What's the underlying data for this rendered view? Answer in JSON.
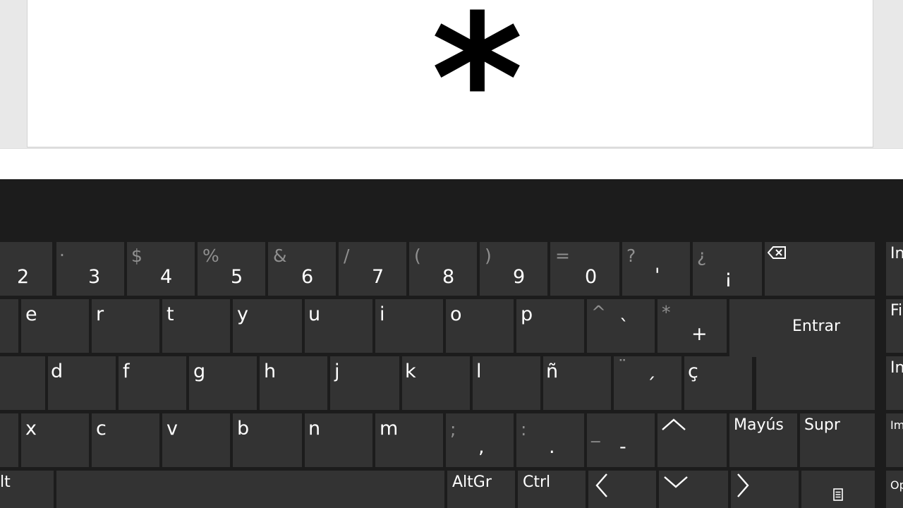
{
  "document": {
    "symbol": "*"
  },
  "keyboard": {
    "rows": [
      [
        {
          "id": "2",
          "main": "2",
          "sec": ""
        },
        {
          "id": "3",
          "main": "3",
          "sec": "·"
        },
        {
          "id": "4",
          "main": "4",
          "sec": "$"
        },
        {
          "id": "5",
          "main": "5",
          "sec": "%"
        },
        {
          "id": "6",
          "main": "6",
          "sec": "&"
        },
        {
          "id": "7",
          "main": "7",
          "sec": "/"
        },
        {
          "id": "8",
          "main": "8",
          "sec": "("
        },
        {
          "id": "9",
          "main": "9",
          "sec": ")"
        },
        {
          "id": "0",
          "main": "0",
          "sec": "="
        },
        {
          "id": "apostrophe",
          "main": "'",
          "sec": "?"
        },
        {
          "id": "inverted-exclamation",
          "main": "¡",
          "sec": "¿"
        }
      ],
      [
        {
          "id": "e",
          "main": "e"
        },
        {
          "id": "r",
          "main": "r"
        },
        {
          "id": "t",
          "main": "t"
        },
        {
          "id": "y",
          "main": "y"
        },
        {
          "id": "u",
          "main": "u"
        },
        {
          "id": "i",
          "main": "i"
        },
        {
          "id": "o",
          "main": "o"
        },
        {
          "id": "p",
          "main": "p"
        },
        {
          "id": "grave",
          "main": "`",
          "sec": "^"
        },
        {
          "id": "plus",
          "main": "+",
          "sec": "*"
        }
      ],
      [
        {
          "id": "d",
          "main": "d"
        },
        {
          "id": "f",
          "main": "f"
        },
        {
          "id": "g",
          "main": "g"
        },
        {
          "id": "h",
          "main": "h"
        },
        {
          "id": "j",
          "main": "j"
        },
        {
          "id": "k",
          "main": "k"
        },
        {
          "id": "l",
          "main": "l"
        },
        {
          "id": "enye",
          "main": "ñ"
        },
        {
          "id": "acute",
          "main": "´",
          "sec": "¨"
        },
        {
          "id": "cedilla",
          "main": "ç"
        }
      ],
      [
        {
          "id": "x",
          "main": "x"
        },
        {
          "id": "c",
          "main": "c"
        },
        {
          "id": "v",
          "main": "v"
        },
        {
          "id": "b",
          "main": "b"
        },
        {
          "id": "n",
          "main": "n"
        },
        {
          "id": "m",
          "main": "m"
        },
        {
          "id": "comma",
          "main": ",",
          "sec": ";"
        },
        {
          "id": "period",
          "main": ".",
          "sec": ":"
        },
        {
          "id": "hyphen",
          "main": "-",
          "sec": "_"
        }
      ]
    ],
    "labels": {
      "enter": "Entrar",
      "shift": "Mayús",
      "delete": "Supr",
      "alt": "lt",
      "altgr": "AltGr",
      "ctrl": "Ctrl"
    },
    "side_keys": [
      "In",
      "Fi",
      "In",
      "Im",
      "Op"
    ],
    "icons": {
      "backspace": "backspace-icon",
      "up": "arrow-up-icon",
      "down": "arrow-down-icon",
      "left": "arrow-left-icon",
      "right": "arrow-right-icon",
      "menu": "context-menu-icon"
    }
  }
}
